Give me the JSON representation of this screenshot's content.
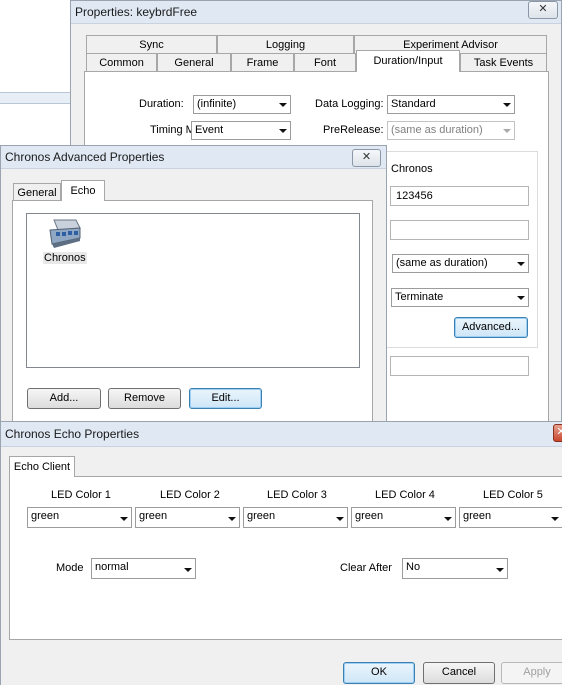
{
  "properties_window": {
    "title": "Properties: keybrdFree",
    "close_label": "✕",
    "tabs_row1": [
      "Sync",
      "Logging",
      "Experiment Advisor"
    ],
    "tabs_row2": [
      "Common",
      "General",
      "Frame",
      "Font",
      "Duration/Input",
      "Task Events"
    ],
    "duration_label": "Duration:",
    "duration_value": "(infinite)",
    "data_logging_label": "Data Logging:",
    "data_logging_value": "Standard",
    "timing_mode_label": "Timing Mode:",
    "timing_mode_value": "Event",
    "prerelease_label": "PreRelease:",
    "prerelease_value": "(same as duration)",
    "device_heading": "Chronos",
    "allowable_value": "123456",
    "correct_value": "",
    "time_limit_value": "(same as duration)",
    "end_action_value": "Terminate",
    "advanced_button": "Advanced...",
    "extra_value": ""
  },
  "advanced_window": {
    "title": "Chronos Advanced Properties",
    "close_label": "✕",
    "tabs": [
      "General",
      "Echo"
    ],
    "list_items": [
      {
        "label": "Chronos",
        "icon": "chronos-device-icon"
      }
    ],
    "add_button": "Add...",
    "remove_button": "Remove",
    "edit_button": "Edit..."
  },
  "echo_window": {
    "title": "Chronos Echo Properties",
    "close_label": "✕",
    "tab": "Echo Client",
    "led_labels": [
      "LED Color 1",
      "LED Color 2",
      "LED Color 3",
      "LED Color 4",
      "LED Color 5"
    ],
    "led_values": [
      "green",
      "green",
      "green",
      "green",
      "green"
    ],
    "mode_label": "Mode",
    "mode_value": "normal",
    "clear_after_label": "Clear After",
    "clear_after_value": "No",
    "ok_button": "OK",
    "cancel_button": "Cancel",
    "apply_button": "Apply"
  }
}
